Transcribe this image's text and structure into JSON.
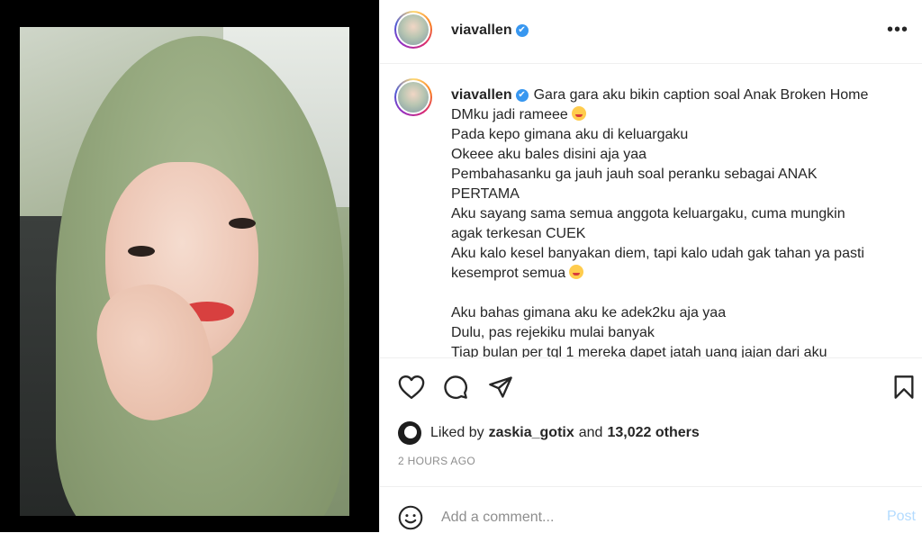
{
  "post": {
    "username": "viavallen",
    "verified_mark": "✔",
    "caption_lines": [
      "Gara gara aku bikin caption soal Anak Broken Home",
      "DMku jadi rameee",
      "Pada kepo gimana aku di keluargaku",
      "Okeee aku bales disini aja yaa",
      "Pembahasanku ga jauh jauh soal peranku sebagai ANAK",
      "PERTAMA",
      "Aku sayang sama semua anggota keluargaku, cuma mungkin",
      "agak terkesan CUEK",
      "Aku kalo kesel banyakan diem, tapi kalo udah gak tahan ya pasti",
      "kesemprot semua",
      "",
      "Aku bahas gimana aku ke adek2ku aja yaa",
      "Dulu, pas rejekiku mulai banyak",
      "Tiap bulan per tgl 1 mereka dapet jatah uang jajan dari aku"
    ],
    "emoji_after_lines": [
      1,
      9
    ],
    "emoji_name": "grinning-sweat-emoji",
    "liked_by_prefix": "Liked by",
    "liked_by_user": "zaskia_gotix",
    "liked_by_joiner": "and",
    "liked_by_others": "13,022 others",
    "timestamp": "2 HOURS AGO",
    "more_label": "•••"
  },
  "comment": {
    "placeholder": "Add a comment...",
    "post_label": "Post"
  },
  "icons": {
    "like": "heart-icon",
    "comment": "comment-bubble-icon",
    "share": "paper-plane-icon",
    "save": "bookmark-icon",
    "emoji": "smiley-icon"
  },
  "colors": {
    "verified": "#3897f0",
    "post_button": "#b3dbff",
    "muted": "#8e8e8e",
    "text": "#262626"
  }
}
